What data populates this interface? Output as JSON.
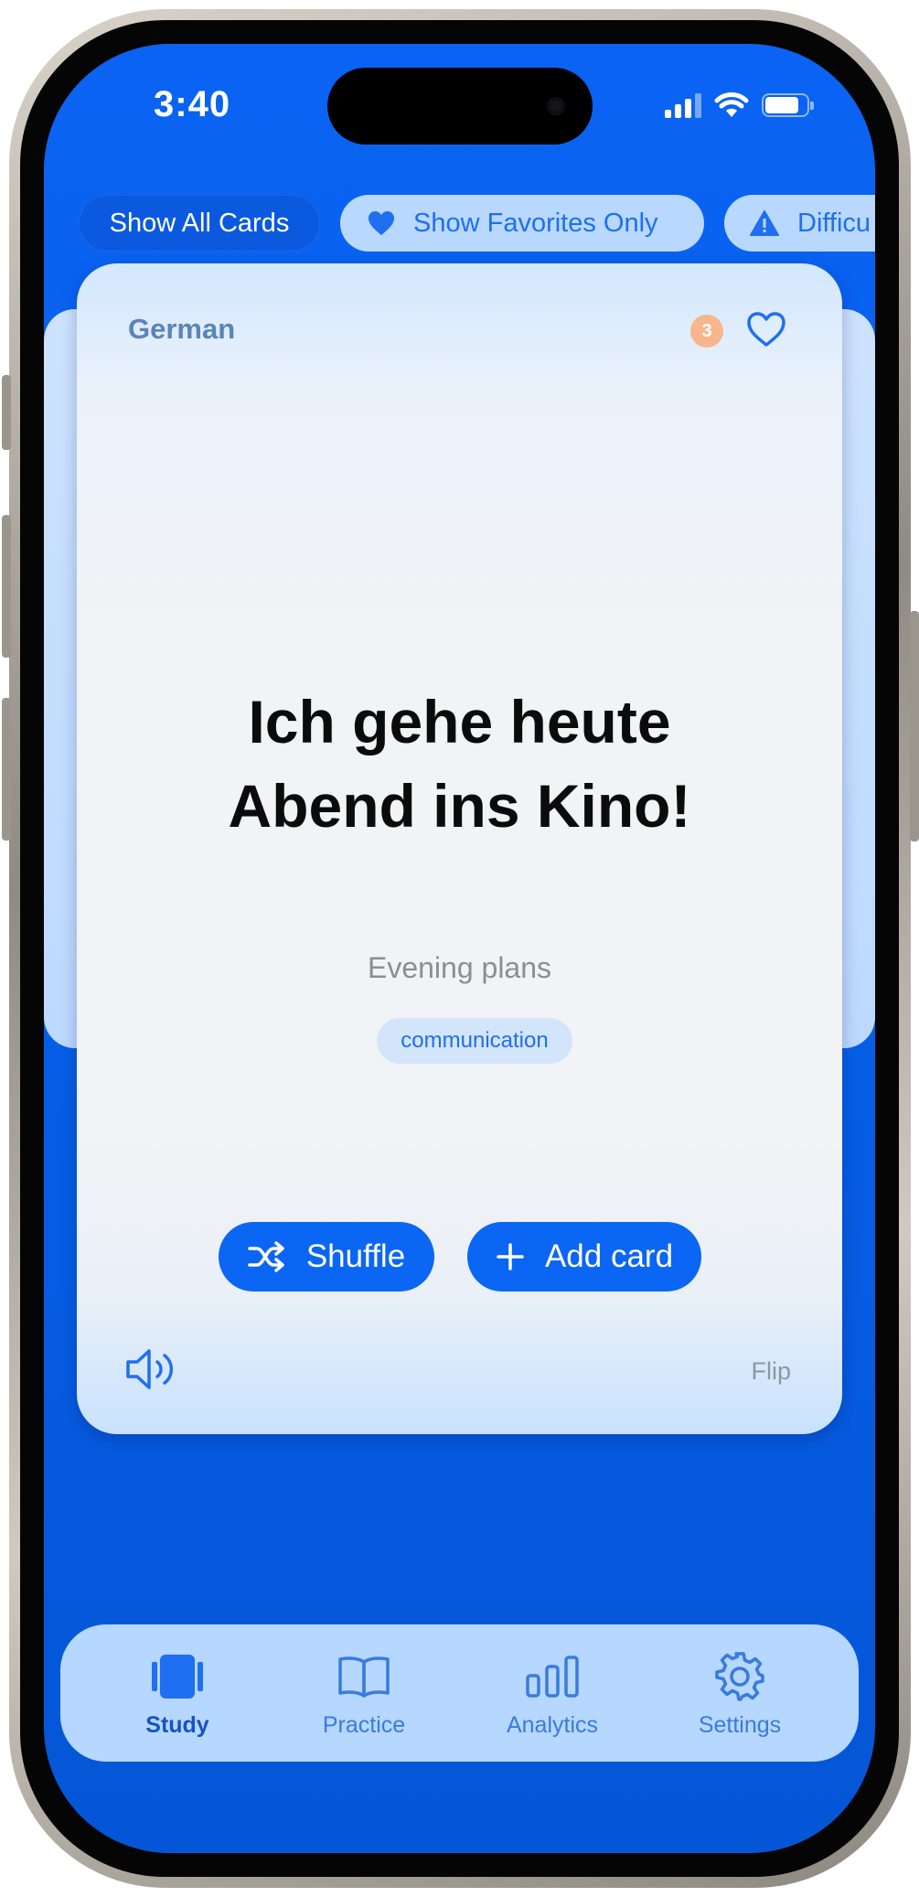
{
  "status_bar": {
    "time": "3:40"
  },
  "filters": [
    {
      "label": "Show All Cards",
      "icon": ""
    },
    {
      "label": "Show Favorites Only",
      "icon": "heart-filled-icon"
    },
    {
      "label": "Difficu",
      "icon": "warning-triangle-icon"
    }
  ],
  "card": {
    "language": "German",
    "badge_count": "3",
    "phrase_line1": "Ich gehe heute",
    "phrase_line2": "Abend ins Kino!",
    "subtitle": "Evening plans",
    "tag": "communication",
    "flip_label": "Flip"
  },
  "actions": {
    "shuffle_label": "Shuffle",
    "add_label": "Add card"
  },
  "tabs": [
    {
      "label": "Study",
      "icon": "study-cards-icon",
      "active": true
    },
    {
      "label": "Practice",
      "icon": "book-icon",
      "active": false
    },
    {
      "label": "Analytics",
      "icon": "bar-chart-icon",
      "active": false
    },
    {
      "label": "Settings",
      "icon": "gear-icon",
      "active": false
    }
  ],
  "colors": {
    "background_blue": "#0761ec",
    "accent": "#1f6ff0",
    "chip_light": "#b8d8ff",
    "badge_orange": "#f7b68b"
  }
}
